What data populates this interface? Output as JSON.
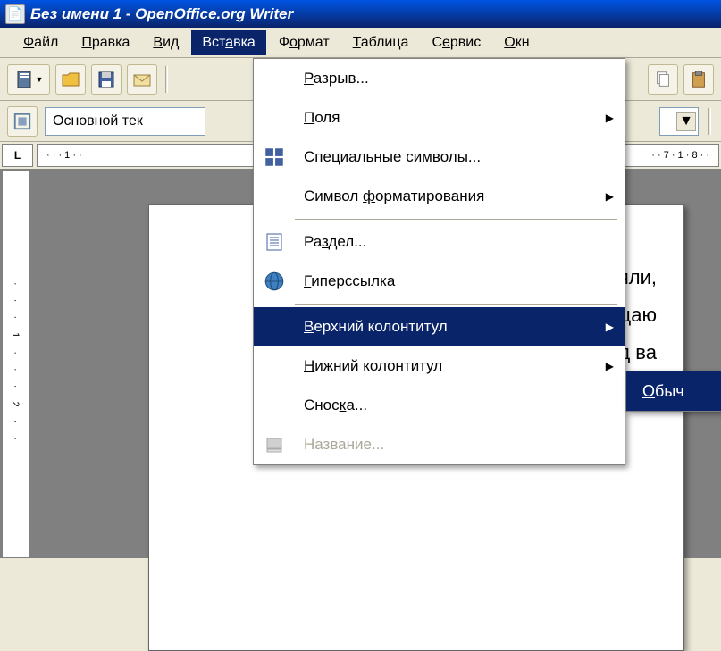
{
  "window": {
    "title": "Без имени 1 - OpenOffice.org Writer"
  },
  "menubar": {
    "file": "Файл",
    "edit": "Правка",
    "view": "Вид",
    "insert": "Вставка",
    "format": "Формат",
    "table": "Таблица",
    "tools": "Сервис",
    "window": "Окн"
  },
  "toolbar2": {
    "style": "Основной тек"
  },
  "ruler": {
    "corner": "L",
    "h_marks": "· · · 1 · ·",
    "h_marks_right": "· · 7 · 1 · 8 · ·",
    "v_marks": "· · · 1 · · · 2 · ·"
  },
  "insert_menu": {
    "break": "Разрыв...",
    "fields": "Поля",
    "special_chars": "Специальные символы...",
    "formatting_mark": "Символ форматирования",
    "section": "Раздел...",
    "hyperlink": "Гиперссылка",
    "header": "Верхний колонтитул",
    "footer": "Нижний колонтитул",
    "footnote": "Сноска...",
    "caption": "Название..."
  },
  "submenu": {
    "default": "Обыч"
  },
  "document": {
    "line1": "яли,",
    "line2": "рицаю",
    "line3": "ред ва"
  }
}
